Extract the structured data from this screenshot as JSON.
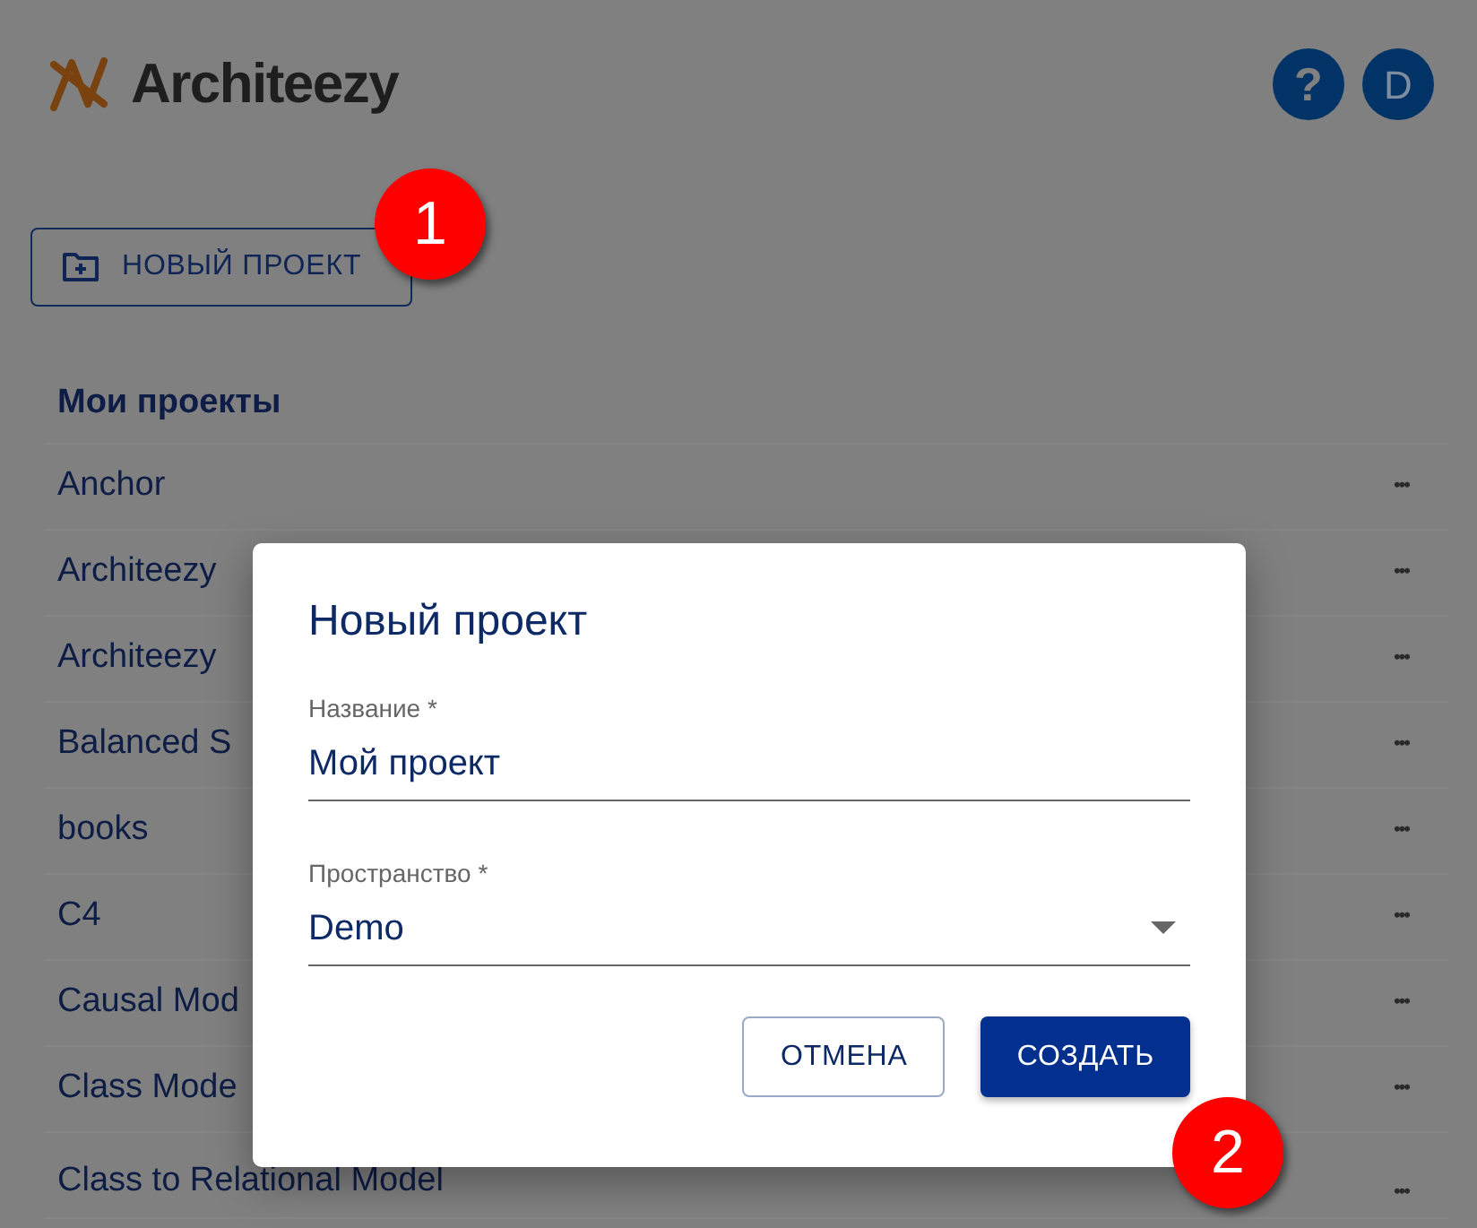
{
  "header": {
    "logo": "Architeezy",
    "help": "?",
    "avatar": "D"
  },
  "new_project_button": "НОВЫЙ ПРОЕКТ",
  "projects": {
    "title": "Мои проекты",
    "rows": [
      {
        "name": "Anchor",
        "menu": "•••"
      },
      {
        "name": "Architeezy",
        "menu": "•••"
      },
      {
        "name": "Architeezy",
        "menu": "•••"
      },
      {
        "name": "Balanced S",
        "menu": "•••"
      },
      {
        "name": "books",
        "menu": "•••"
      },
      {
        "name": "C4",
        "menu": "•••"
      },
      {
        "name": "Causal Mod",
        "menu": "•••"
      },
      {
        "name": "Class Mode",
        "menu": "•••"
      },
      {
        "name": "Class to Relational Model",
        "menu": "•••"
      }
    ]
  },
  "dialog": {
    "title": "Новый проект",
    "fields": [
      {
        "kind": "text",
        "label": "Название *",
        "value": "Мой проект"
      },
      {
        "kind": "select",
        "label": "Пространство *",
        "value": "Demo"
      }
    ],
    "buttons": [
      {
        "label": "ОТМЕНА",
        "primary": false
      },
      {
        "label": "СОЗДАТЬ",
        "primary": true
      }
    ]
  },
  "callouts": [
    "1",
    "2"
  ]
}
